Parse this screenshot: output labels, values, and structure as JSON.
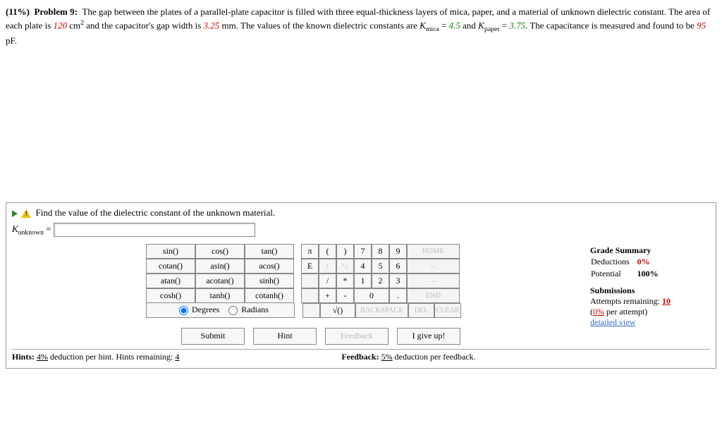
{
  "problem": {
    "weight_label": "(11%)",
    "title": "Problem 9:",
    "text1": "The gap between the plates of a parallel-plate capacitor is filled with three equal-thickness layers of mica, paper, and a material of unknown dielectric constant. The area of each plate is ",
    "area": "120",
    "area_unit": " cm",
    "area_exp": "2",
    "text2": " and the capacitor's gap width is ",
    "gap": "3.25",
    "gap_unit": " mm. The values of the known dielectric constants are ",
    "kmica_label": "K",
    "kmica_sub": "mica",
    "eq": " = ",
    "kmica_val": "4.5",
    "and": " and ",
    "kpaper_label": "K",
    "kpaper_sub": "paper",
    "kpaper_val": "3.75",
    "text3": ". The capacitance is measured and found to be ",
    "cap": "95",
    "cap_unit": " pF."
  },
  "part": {
    "instruction": "Find the value of the dielectric constant of the unknown material.",
    "var_base": "K",
    "var_sub": "unknown",
    "eq": " = ",
    "input_value": ""
  },
  "keypad": {
    "funcs_r1": [
      "sin()",
      "cos()",
      "tan()"
    ],
    "funcs_r2": [
      "cotan()",
      "asin()",
      "acos()"
    ],
    "funcs_r3": [
      "atan()",
      "acotan()",
      "sinh()"
    ],
    "funcs_r4": [
      "cosh()",
      "tanh()",
      "cotanh()"
    ],
    "syms_r1": [
      "π",
      "(",
      ")",
      "7",
      "8",
      "9"
    ],
    "syms_r2": [
      "E",
      "↑",
      "^↓",
      "4",
      "5",
      "6"
    ],
    "syms_r3": [
      "/",
      "*",
      "1",
      "2",
      "3"
    ],
    "syms_r4": [
      "+",
      "-",
      "0",
      "."
    ],
    "home": "HOME",
    "arrow_left": "←",
    "arrow_right": "→",
    "end": "END",
    "backspace": "BACKSPACE",
    "del": "DEL",
    "clear": "CLEAR",
    "sqrt": "√()",
    "degrees_label": "Degrees",
    "radians_label": "Radians"
  },
  "actions": {
    "submit": "Submit",
    "hint": "Hint",
    "feedback": "Feedback",
    "giveup": "I give up!"
  },
  "sidebar": {
    "grade_heading": "Grade Summary",
    "deductions_label": "Deductions",
    "deductions_val": "0%",
    "potential_label": "Potential",
    "potential_val": "100%",
    "subs_heading": "Submissions",
    "attempts_label": "Attempts remaining: ",
    "attempts_val": "10",
    "per_attempt_pre": "(",
    "per_attempt_pct": "0%",
    "per_attempt_post": " per attempt)",
    "detailed": "detailed view"
  },
  "footer": {
    "hints_label": "Hints: ",
    "hints_pct": "4%",
    "hints_text": " deduction per hint. Hints remaining: ",
    "hints_remaining": "4",
    "feedback_label": "Feedback: ",
    "feedback_pct": "5%",
    "feedback_text": " deduction per feedback."
  }
}
